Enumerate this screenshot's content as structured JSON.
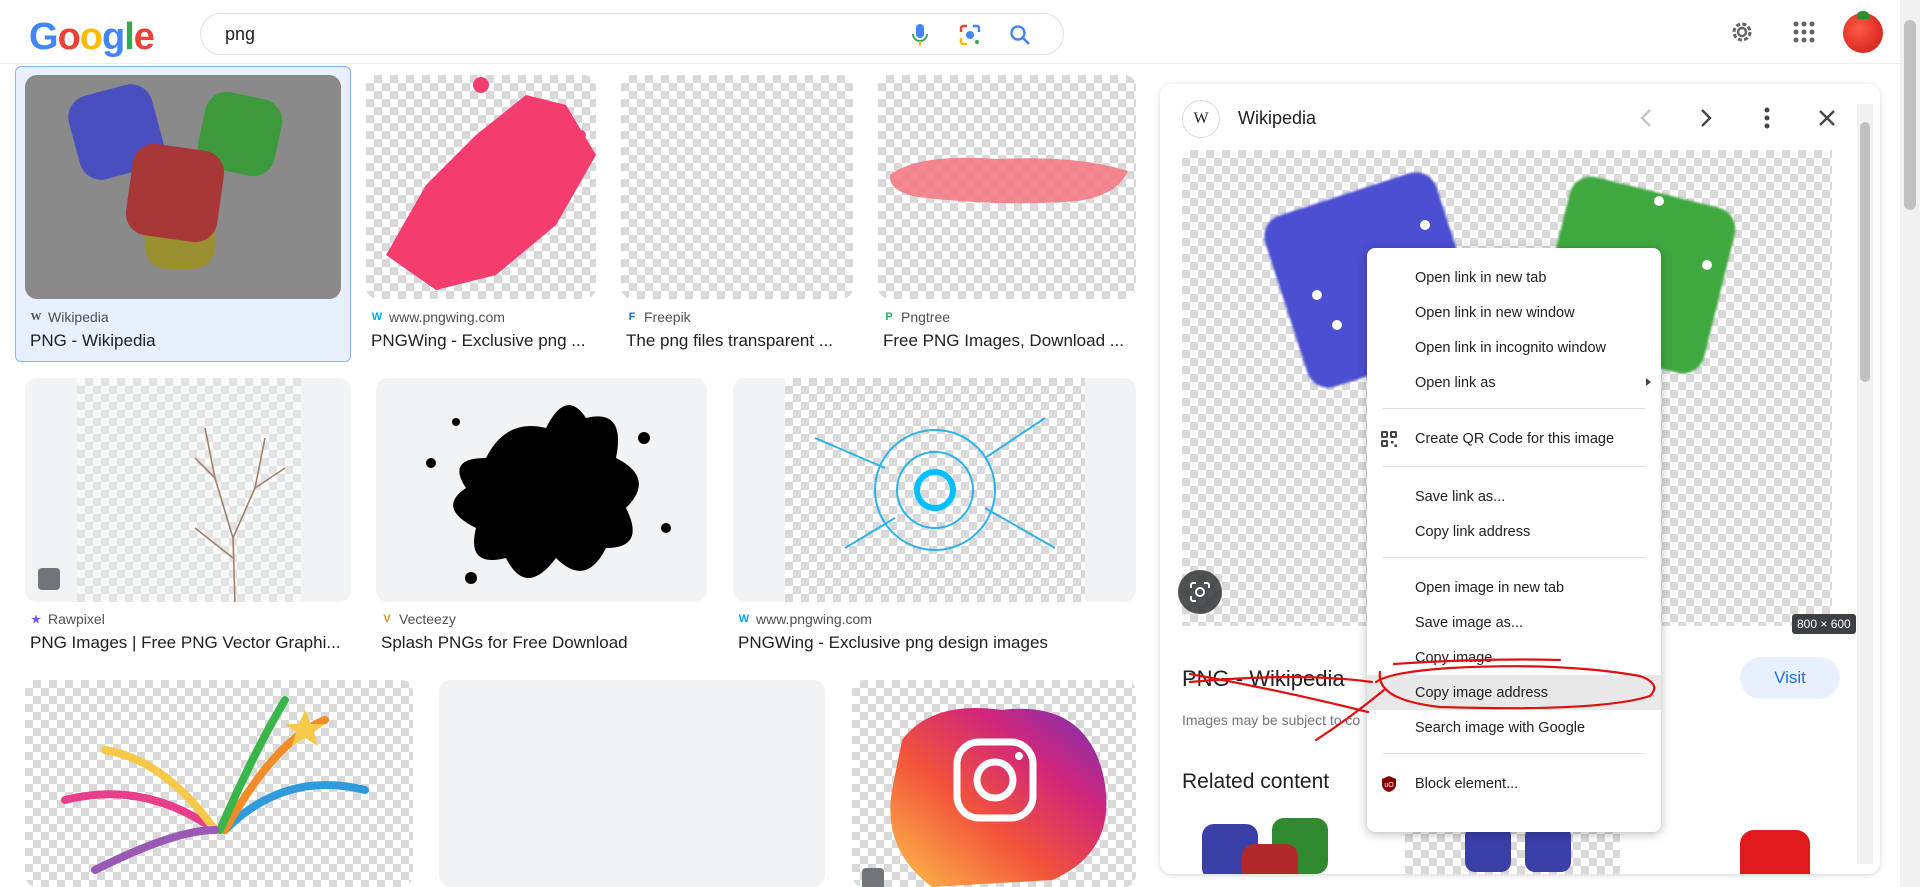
{
  "header": {
    "logo_text": [
      "G",
      "o",
      "o",
      "g",
      "l",
      "e"
    ],
    "search_value": "png",
    "search_icon": "search-icon",
    "mic_icon": "mic-icon",
    "lens_icon": "lens-icon",
    "settings_icon": "gear-icon",
    "apps_icon": "apps-grid-icon"
  },
  "results": [
    {
      "source": "Wikipedia",
      "title": "PNG - Wikipedia",
      "favicon": "W"
    },
    {
      "source": "www.pngwing.com",
      "title": "PNGWing - Exclusive png ...",
      "favicon": "W"
    },
    {
      "source": "Freepik",
      "title": "The png files transparent ...",
      "favicon": "F"
    },
    {
      "source": "Pngtree",
      "title": "Free PNG Images, Download ...",
      "favicon": "P"
    },
    {
      "source": "Rawpixel",
      "title": "PNG Images | Free PNG Vector Graphi...",
      "favicon": "★"
    },
    {
      "source": "Vecteezy",
      "title": "Splash PNGs for Free Download",
      "favicon": "V"
    },
    {
      "source": "www.pngwing.com",
      "title": "PNGWing - Exclusive png design images",
      "favicon": "W"
    }
  ],
  "panel": {
    "site": "Wikipedia",
    "site_logo": "W",
    "dimensions": "800 × 600",
    "title": "PNG - Wikipedia",
    "visit_label": "Visit",
    "copyright_note": "Images may be subject to co",
    "related_heading": "Related content"
  },
  "context_menu": {
    "items": [
      "Open link in new tab",
      "Open link in new window",
      "Open link in incognito window",
      "Open link as",
      "Create QR Code for this image",
      "Save link as...",
      "Copy link address",
      "Open image in new tab",
      "Save image as...",
      "Copy image",
      "Copy image address",
      "Search image with Google",
      "Block element..."
    ],
    "highlighted": "Copy image address"
  },
  "colors": {
    "accent": "#1a73e8",
    "annotation": "#e01010"
  }
}
